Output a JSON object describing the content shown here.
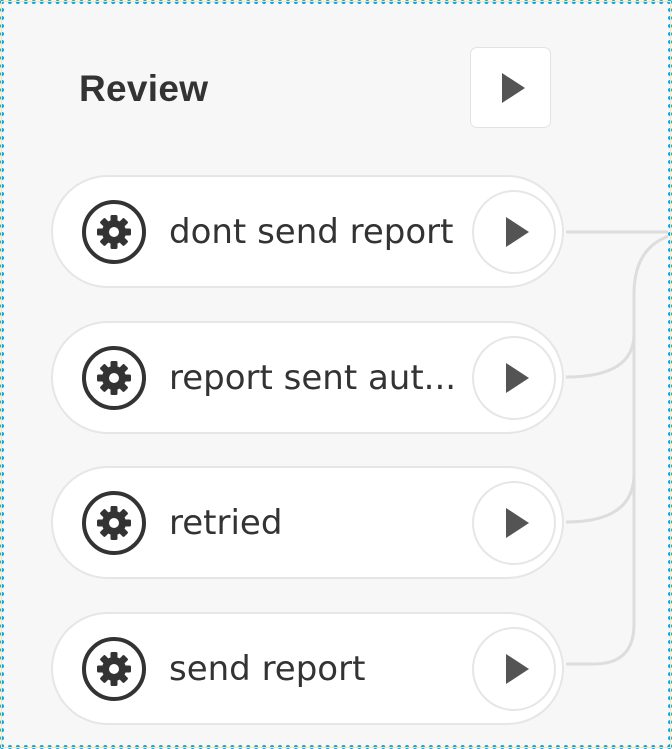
{
  "group": {
    "title": "Review",
    "play_icon": "play-icon"
  },
  "nodes": [
    {
      "label": "dont send report",
      "icon": "gear-icon",
      "action_icon": "play-icon"
    },
    {
      "label": "report sent aut...",
      "icon": "gear-icon",
      "action_icon": "play-icon"
    },
    {
      "label": "retried",
      "icon": "gear-icon",
      "action_icon": "play-icon"
    },
    {
      "label": "send report",
      "icon": "gear-icon",
      "action_icon": "play-icon"
    }
  ],
  "colors": {
    "selection_border": "#14a3de",
    "panel_background": "#f7f7f7",
    "node_border": "#e6e6e6",
    "connector": "#dddddd",
    "text": "#333333"
  }
}
